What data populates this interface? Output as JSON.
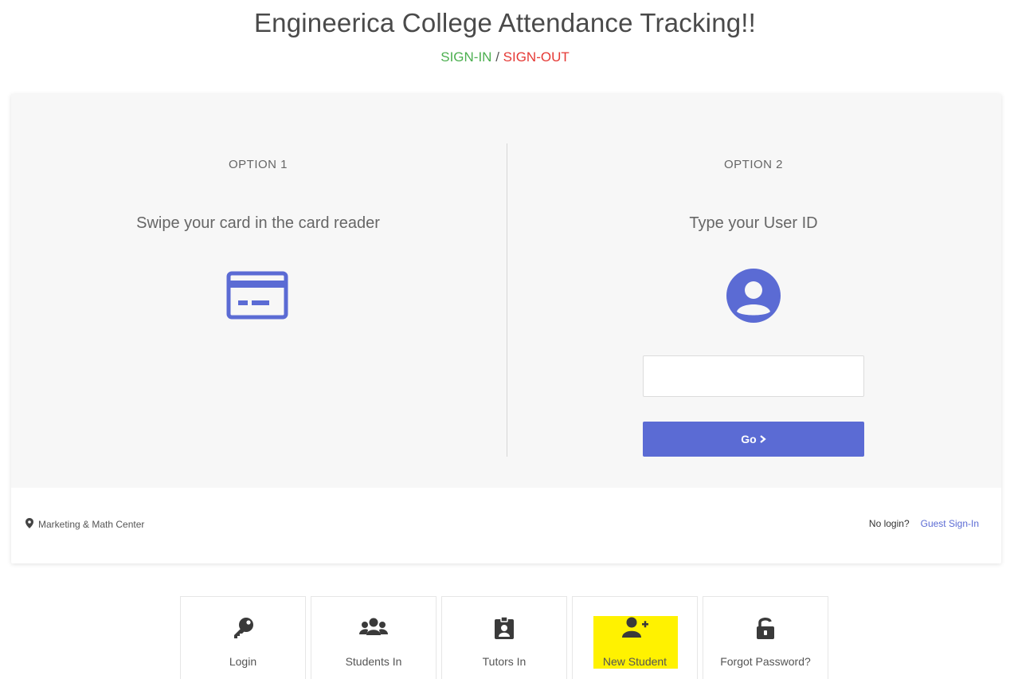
{
  "header": {
    "title": "Engineerica College Attendance Tracking!!",
    "sign_in": "SIGN-IN",
    "separator": " / ",
    "sign_out": "SIGN-OUT"
  },
  "option1": {
    "label": "OPTION 1",
    "instruction": "Swipe your card in the card reader",
    "icon": "credit-card-icon"
  },
  "option2": {
    "label": "OPTION 2",
    "instruction": "Type your User ID",
    "icon": "account-circle-icon",
    "user_id_value": "",
    "go_label": "Go",
    "go_icon": "chevron-right-icon"
  },
  "footer": {
    "location_icon": "map-marker-icon",
    "location": "Marketing & Math Center",
    "no_login": "No login?",
    "guest_link": "Guest Sign-In"
  },
  "tiles": [
    {
      "label": "Login",
      "icon": "key-icon"
    },
    {
      "label": "Students In",
      "icon": "users-icon"
    },
    {
      "label": "Tutors In",
      "icon": "id-badge-icon"
    },
    {
      "label": "New Student",
      "icon": "user-plus-icon",
      "highlighted": true
    },
    {
      "label": "Forgot Password?",
      "icon": "unlock-icon"
    }
  ],
  "colors": {
    "accent": "#5b6bd4",
    "sign_in": "#4caf50",
    "sign_out": "#e53935",
    "highlight": "#fff200"
  }
}
